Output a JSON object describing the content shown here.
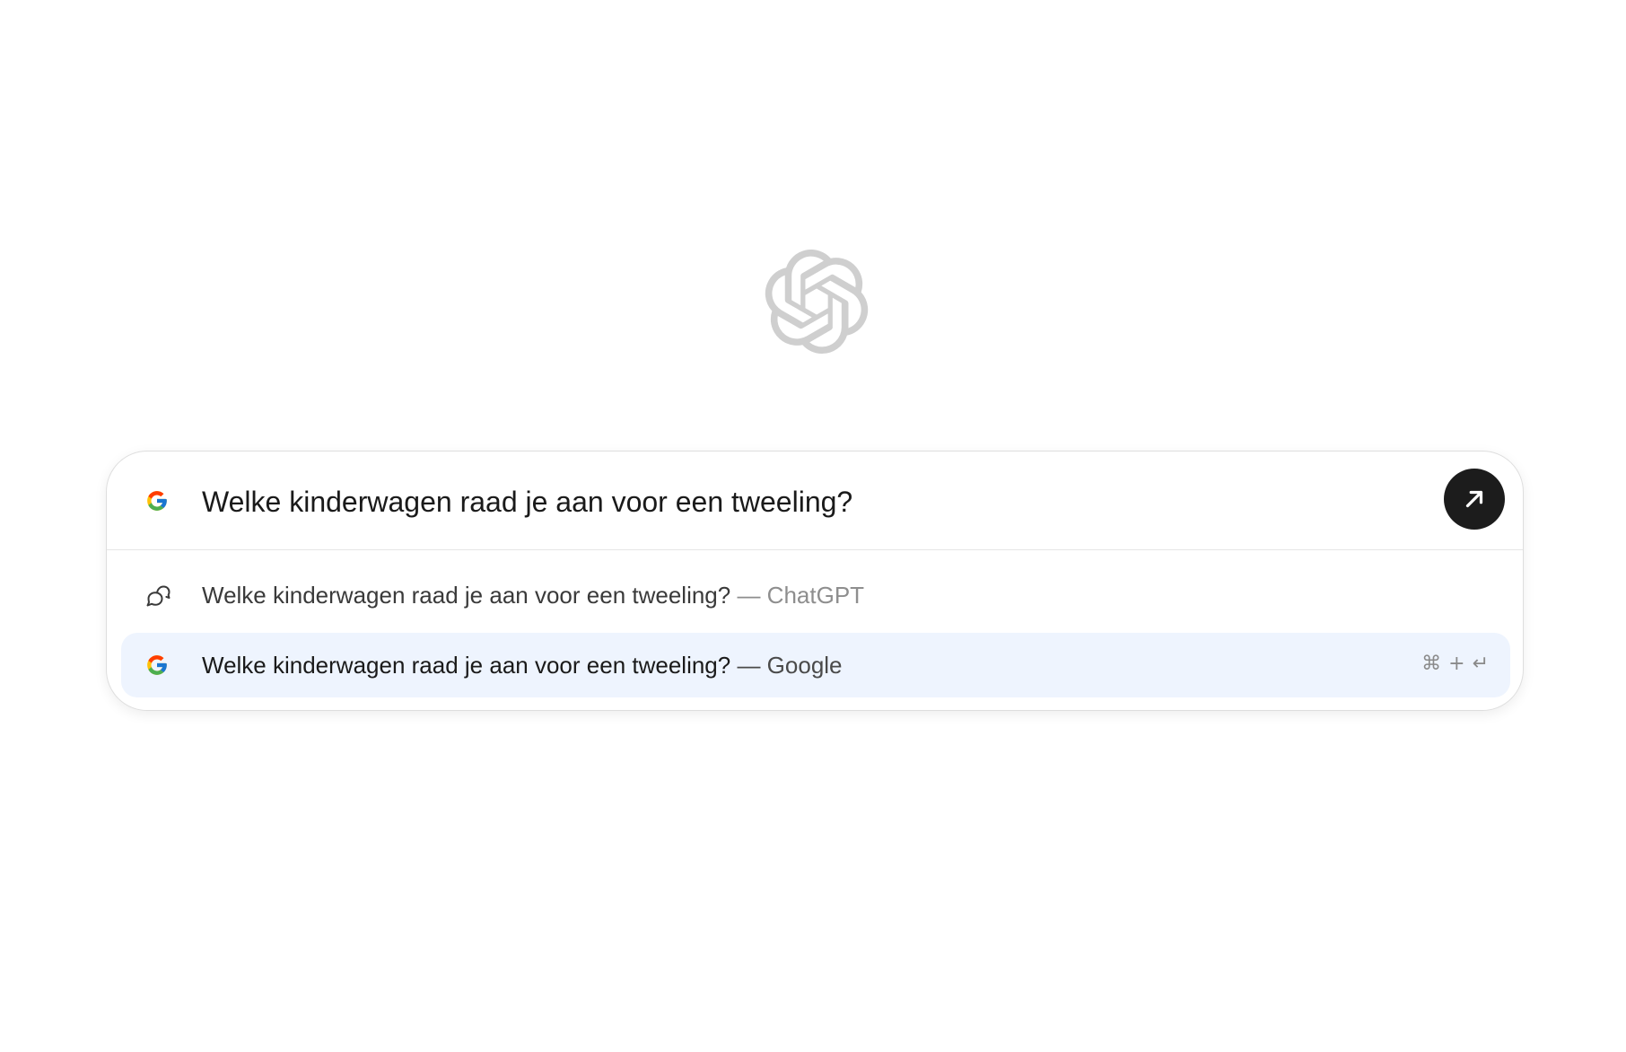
{
  "search": {
    "query": "Welke kinderwagen raad je aan voor een tweeling?",
    "engine_icon": "google-g-icon",
    "submit_icon": "arrow-up-right-icon"
  },
  "suggestions": [
    {
      "icon": "chat-bubbles-icon",
      "query": "Welke kinderwagen raad je aan voor een tweeling?",
      "source": " — ChatGPT"
    },
    {
      "icon": "google-g-icon",
      "query": "Welke kinderwagen raad je aan voor een tweeling?",
      "source": " — Google",
      "shortcut": {
        "modifier": "⌘",
        "plus": "+",
        "key": "↵"
      }
    }
  ],
  "colors": {
    "highlight": "#eef4fe",
    "submit_bg": "#1c1c1c",
    "logo": "#cfcfcf"
  }
}
